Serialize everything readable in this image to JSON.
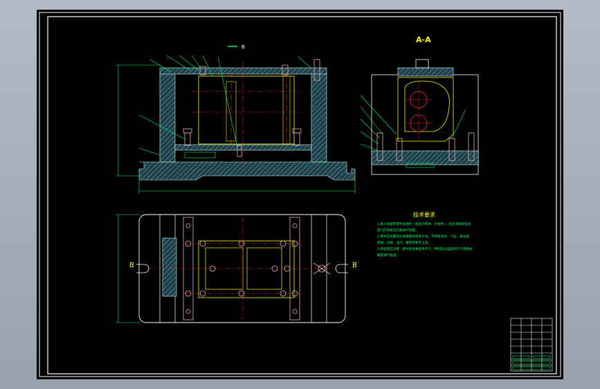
{
  "section_title": "A-A",
  "section_marker_top": "B",
  "section_marker_left": "B",
  "section_marker_right": "B",
  "tech_title": "技术要求",
  "tech_notes": [
    "1.进入装配的零件及部件（包括外购件、外协件），均必须具有检验",
    "部门的合格证方能进行装配。",
    "2.零件在装配前必须清理和清洗干净，不得有毛刺、飞边、氧化皮、",
    "锈蚀、切屑、油污、着色剂和灰尘等。",
    "3.装配前应对零、部件的主要配合尺寸，特别是过盈配合尺寸及相关",
    "精度进行复查。"
  ],
  "colors": {
    "background": "#000000",
    "frame": "#ffffff",
    "hatch": "#4a8fa0",
    "part_outline": "#ffff00",
    "center_line": "#ff2a2a",
    "bolt": "#e8b0b0",
    "annotation": "#00ff66",
    "dimension": "#00ff66"
  }
}
